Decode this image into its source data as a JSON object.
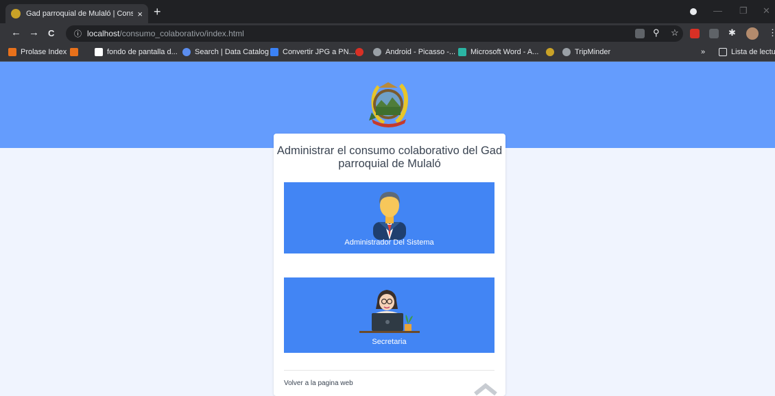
{
  "browser": {
    "tab_title": "Gad parroquial de Mulaló | Cons",
    "tab_close": "×",
    "new_tab": "+",
    "url_host": "localhost",
    "url_path": "/consumo_colaborativo/index.html",
    "back": "←",
    "forward": "→",
    "reload": "C",
    "info": "ⓘ",
    "star": "☆",
    "zoom": "⚲",
    "extensions": "✱",
    "menu": "⋮",
    "minimize": "—",
    "maximize": "❐",
    "close_window": "✕"
  },
  "bookmarks": {
    "items": [
      {
        "label": "Prolase Index",
        "color": "#e8711b"
      },
      {
        "label": "",
        "color": "#e8711b"
      },
      {
        "label": "fondo de pantalla d...",
        "color": "#ffffff"
      },
      {
        "label": "Search | Data Catalog",
        "color": "#5b8def"
      },
      {
        "label": "Convertir JPG a PN...",
        "color": "#3b82f6"
      },
      {
        "label": "",
        "color": "#d93025"
      },
      {
        "label": "Android - Picasso -...",
        "color": "#9aa0a6"
      },
      {
        "label": "Microsoft Word - A...",
        "color": "#2bb5a4"
      },
      {
        "label": "",
        "color": "#c9a227"
      },
      {
        "label": "TripMinder",
        "color": "#9aa0a6"
      }
    ],
    "overflow": "»",
    "reading_list": "Lista de lectura"
  },
  "page": {
    "title": "Administrar el consumo colaborativo del Gad parroquial de Mulaló",
    "roles": [
      {
        "label": "Administrador Del Sistema"
      },
      {
        "label": "Secretaria"
      }
    ],
    "footer_link": "Volver a la pagina web"
  },
  "colors": {
    "hero": "#649cfd",
    "role_card": "#4285f4",
    "background": "#f0f4fe"
  }
}
